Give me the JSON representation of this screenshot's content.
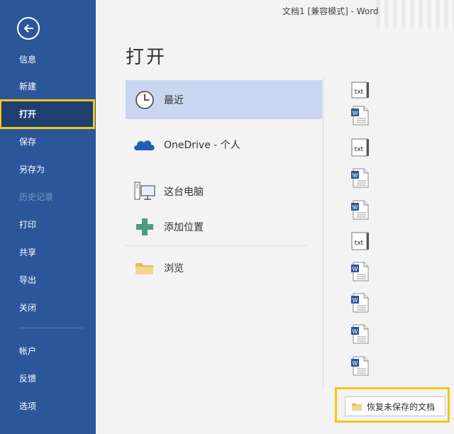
{
  "window": {
    "title": "文档1 [兼容模式]  -  Word"
  },
  "sidebar": {
    "items": [
      {
        "label": "信息",
        "state": "normal"
      },
      {
        "label": "新建",
        "state": "normal"
      },
      {
        "label": "打开",
        "state": "active"
      },
      {
        "label": "保存",
        "state": "normal"
      },
      {
        "label": "另存为",
        "state": "normal"
      },
      {
        "label": "历史记录",
        "state": "disabled"
      },
      {
        "label": "打印",
        "state": "normal"
      },
      {
        "label": "共享",
        "state": "normal"
      },
      {
        "label": "导出",
        "state": "normal"
      },
      {
        "label": "关闭",
        "state": "normal"
      },
      {
        "label": "帐户",
        "state": "normal"
      },
      {
        "label": "反馈",
        "state": "normal"
      },
      {
        "label": "选项",
        "state": "normal"
      }
    ]
  },
  "main": {
    "title": "打开",
    "locations": [
      {
        "label": "最近",
        "icon": "clock-icon",
        "selected": true
      },
      {
        "label": "OneDrive - 个人",
        "icon": "cloud-icon",
        "selected": false
      },
      {
        "label": "这台电脑",
        "icon": "computer-icon",
        "selected": false
      },
      {
        "label": "添加位置",
        "icon": "plus-icon",
        "selected": false
      },
      {
        "label": "浏览",
        "icon": "folder-icon",
        "selected": false
      }
    ],
    "recent_files": [
      {
        "type": "txt"
      },
      {
        "type": "word"
      },
      {
        "type": "txt"
      },
      {
        "type": "word"
      },
      {
        "type": "word"
      },
      {
        "type": "txt"
      },
      {
        "type": "word"
      },
      {
        "type": "word"
      },
      {
        "type": "word"
      },
      {
        "type": "word"
      }
    ],
    "recover_button": {
      "label": "恢复未保存的文档"
    }
  },
  "colors": {
    "sidebar": "#2b579a",
    "active_nav": "#1e3f70",
    "highlight": "#f5c518",
    "selected_location": "#c8d7ef"
  }
}
